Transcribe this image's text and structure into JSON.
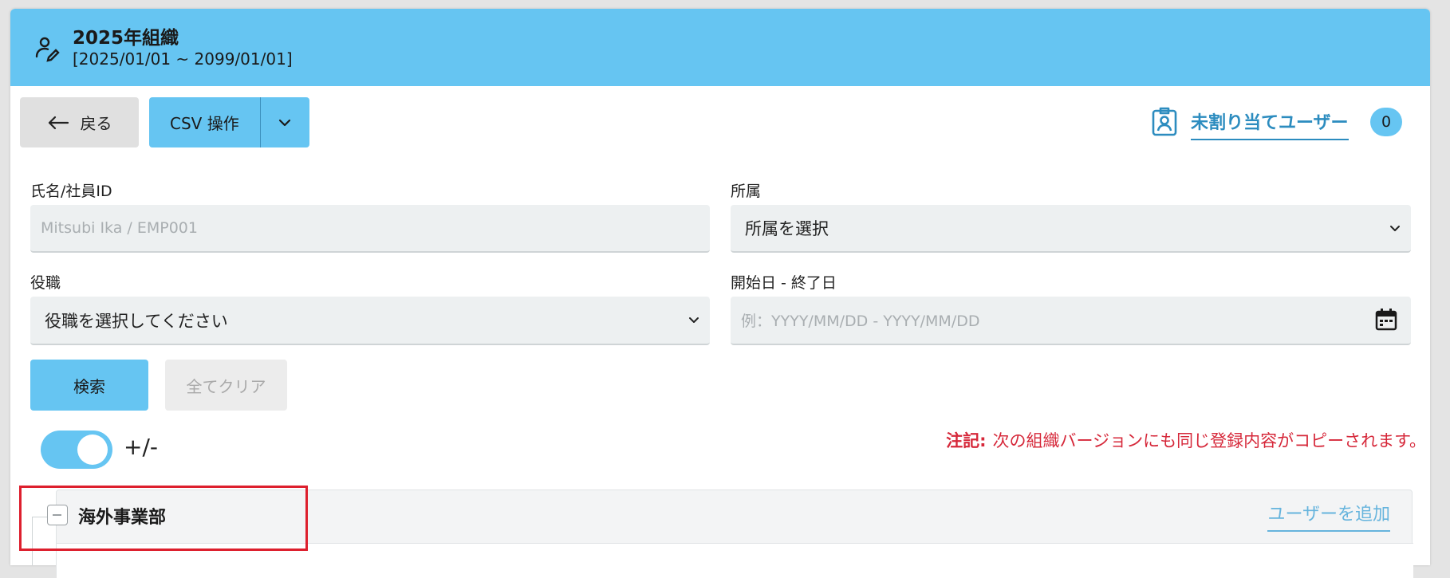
{
  "header": {
    "title": "2025年組織",
    "period": "[2025/01/01 ~ 2099/01/01]"
  },
  "toolbar": {
    "back_label": "戻る",
    "csv_label": "CSV 操作"
  },
  "unassigned": {
    "label": "未割り当てユーザー",
    "count": "0"
  },
  "filters": {
    "name_label": "氏名/社員ID",
    "name_placeholder": "Mitsubi Ika / EMP001",
    "affiliation_label": "所属",
    "affiliation_value": "所属を選択",
    "position_label": "役職",
    "position_value": "役職を選択してください",
    "date_label": "開始日 - 終了日",
    "date_placeholder": "例：YYYY/MM/DD - YYYY/MM/DD"
  },
  "actions": {
    "search_label": "検索",
    "clear_label": "全てクリア"
  },
  "toggle": {
    "label": "+/-",
    "state": "on"
  },
  "note": {
    "prefix": "注記:",
    "text": "次の組織バージョンにも同じ登録内容がコピーされます。"
  },
  "tree": {
    "department_name": "海外事業部",
    "add_user_label": "ユーザーを追加"
  },
  "colors": {
    "accent": "#66c5f2",
    "link": "#2c8cbf",
    "warning": "#d6283a",
    "highlight": "#dd1f2d"
  },
  "icons": {
    "header": "user-edit-icon",
    "back": "arrow-left-icon",
    "csv_menu": "chevron-down-icon",
    "unassigned": "id-badge-icon",
    "date": "calendar-icon",
    "collapse": "minus-square-icon"
  }
}
